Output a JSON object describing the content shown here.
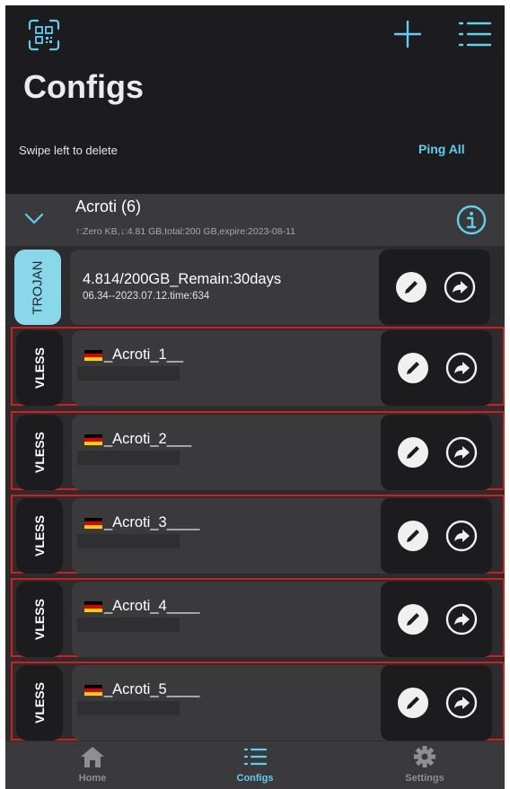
{
  "header": {
    "title": "Configs",
    "hint": "Swipe left to delete",
    "ping_all": "Ping All"
  },
  "group": {
    "name": "Acroti (6)",
    "stats": "↑:Zero KB,↓:4.81 GB,total:200 GB,expire:2023-08-11"
  },
  "configs": [
    {
      "type": "TROJAN",
      "name": "4.814/200GB_Remain:30days",
      "detail": "06.34--2023.07.12.time:634"
    },
    {
      "type": "VLESS",
      "name": "_Acroti_1__",
      "flag": "germany-flag"
    },
    {
      "type": "VLESS",
      "name": "_Acroti_2___",
      "flag": "germany-flag"
    },
    {
      "type": "VLESS",
      "name": "_Acroti_3____",
      "flag": "germany-flag"
    },
    {
      "type": "VLESS",
      "name": "_Acroti_4____",
      "flag": "germany-flag"
    },
    {
      "type": "VLESS",
      "name": "_Acroti_5____",
      "flag": "germany-flag"
    }
  ],
  "tabs": [
    {
      "label": "Home",
      "icon": "home-icon"
    },
    {
      "label": "Configs",
      "icon": "list-icon"
    },
    {
      "label": "Settings",
      "icon": "gear-icon"
    }
  ],
  "colors": {
    "accent": "#5ecff1",
    "trojan_tag": "#88d7ea",
    "highlight_border": "#d81c1c",
    "background": "#2c2c2e"
  }
}
